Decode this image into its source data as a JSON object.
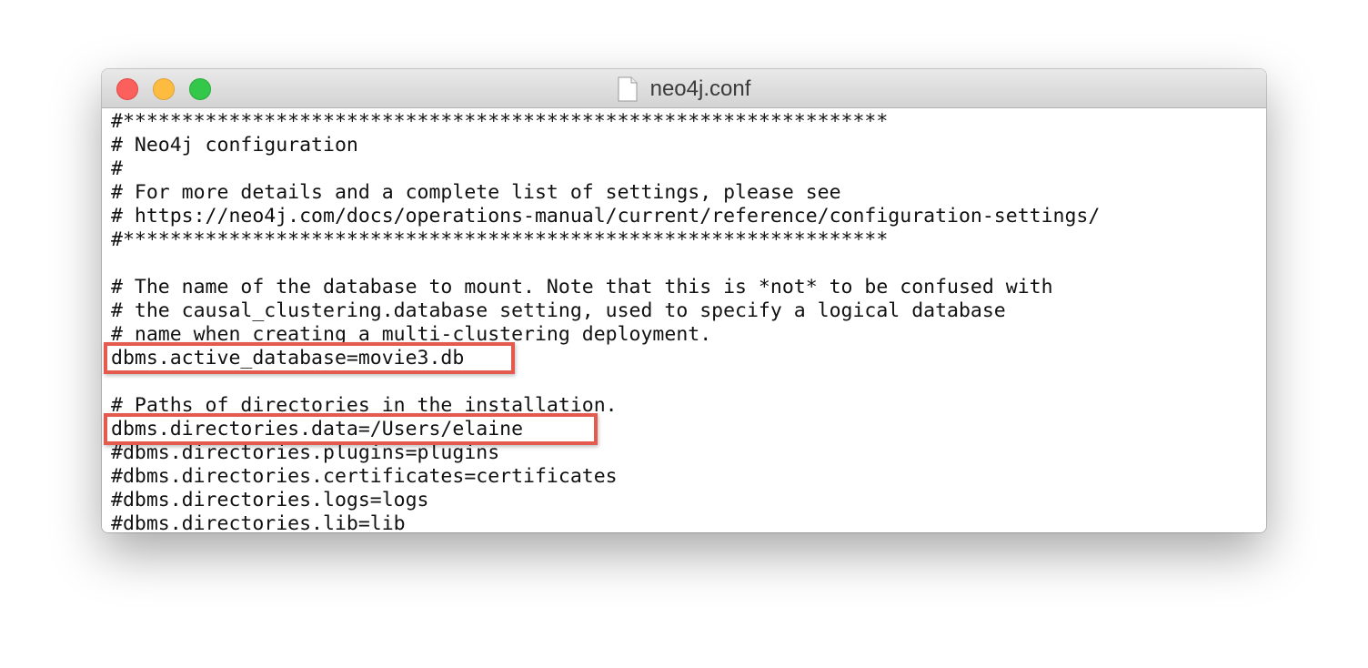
{
  "window": {
    "title": "neo4j.conf",
    "icons": {
      "close": "close-button",
      "minimize": "minimize-button",
      "zoom": "zoom-button",
      "document": "document-icon"
    }
  },
  "editor": {
    "lines": [
      "#*****************************************************************",
      "# Neo4j configuration",
      "#",
      "# For more details and a complete list of settings, please see",
      "# https://neo4j.com/docs/operations-manual/current/reference/configuration-settings/",
      "#*****************************************************************",
      "",
      "# The name of the database to mount. Note that this is *not* to be confused with",
      "# the causal_clustering.database setting, used to specify a logical database",
      "# name when creating a multi-clustering deployment.",
      "dbms.active_database=movie3.db",
      "",
      "# Paths of directories in the installation.",
      "dbms.directories.data=/Users/elaine",
      "#dbms.directories.plugins=plugins",
      "#dbms.directories.certificates=certificates",
      "#dbms.directories.logs=logs",
      "#dbms.directories.lib=lib"
    ]
  },
  "annotations": {
    "highlight_color": "#e55a4e",
    "highlighted_lines": [
      10,
      13
    ]
  }
}
